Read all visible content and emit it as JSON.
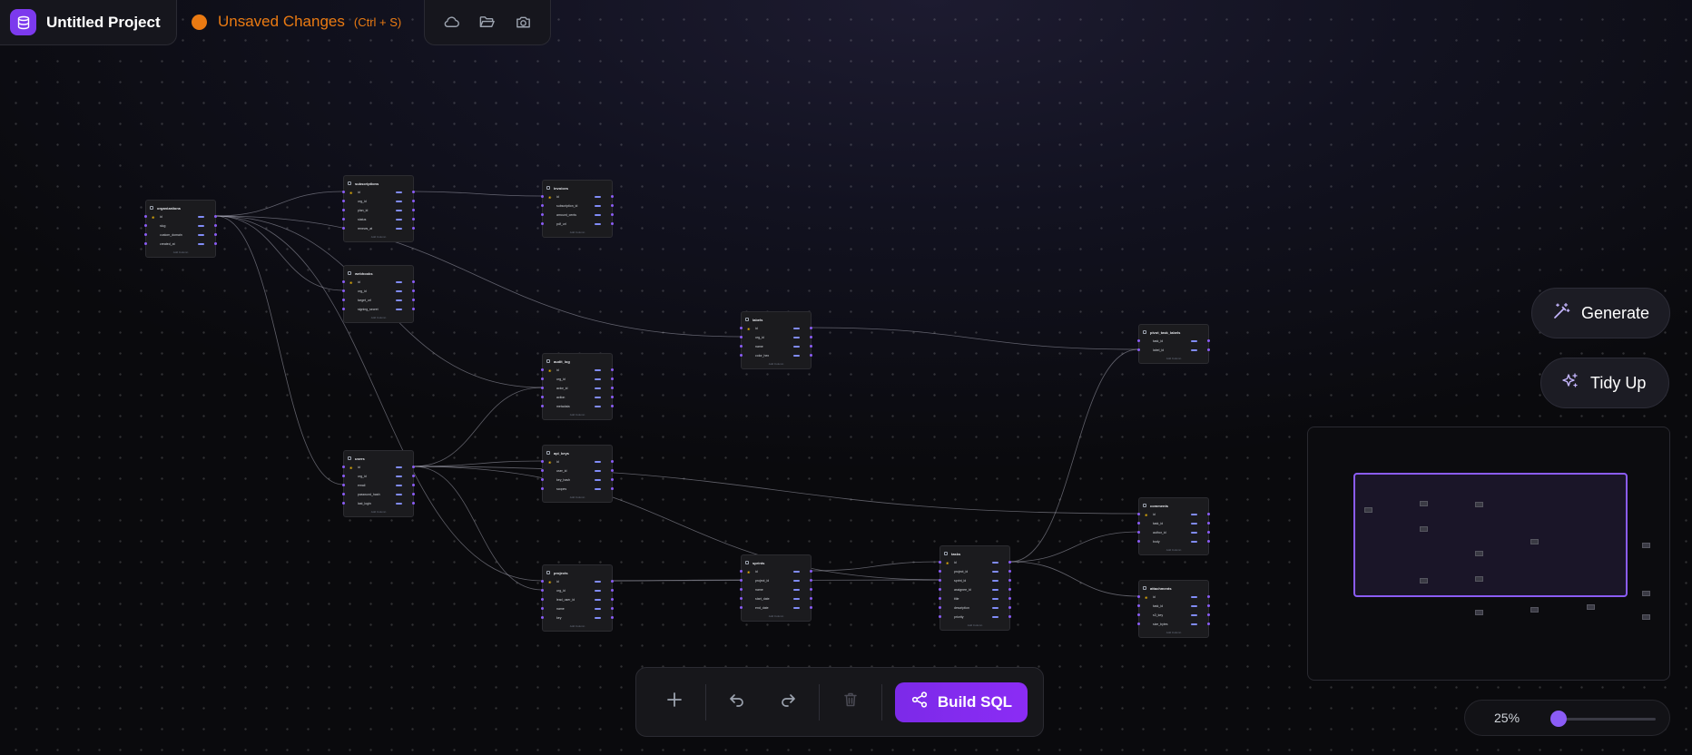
{
  "header": {
    "project_title": "Untitled Project",
    "status_text": "Unsaved Changes",
    "status_shortcut": "(Ctrl + S)",
    "actions": [
      "cloud-icon",
      "folder-open-icon",
      "camera-icon"
    ]
  },
  "colors": {
    "accent": "#8b5cf6",
    "warning": "#ea7a12",
    "build": "#8b2cf5"
  },
  "tables": [
    {
      "name": "organizations",
      "columns": [
        {
          "name": "id",
          "pk": true
        },
        {
          "name": "slug"
        },
        {
          "name": "custom_domain"
        },
        {
          "name": "created_at"
        }
      ],
      "add_label": "Add Column"
    },
    {
      "name": "subscriptions",
      "columns": [
        {
          "name": "id",
          "pk": true
        },
        {
          "name": "org_id"
        },
        {
          "name": "plan_id"
        },
        {
          "name": "status"
        },
        {
          "name": "renews_at"
        }
      ],
      "add_label": "Add Column"
    },
    {
      "name": "invoices",
      "columns": [
        {
          "name": "id",
          "pk": true
        },
        {
          "name": "subscription_id"
        },
        {
          "name": "amount_cents"
        },
        {
          "name": "pdf_url"
        }
      ],
      "add_label": "Add Column"
    },
    {
      "name": "webhooks",
      "columns": [
        {
          "name": "id",
          "pk": true
        },
        {
          "name": "org_id"
        },
        {
          "name": "target_url"
        },
        {
          "name": "signing_secret"
        }
      ],
      "add_label": "Add Column"
    },
    {
      "name": "labels",
      "columns": [
        {
          "name": "id",
          "pk": true
        },
        {
          "name": "org_id"
        },
        {
          "name": "name"
        },
        {
          "name": "color_hex"
        }
      ],
      "add_label": "Add Column"
    },
    {
      "name": "pivot_task_labels",
      "columns": [
        {
          "name": "task_id"
        },
        {
          "name": "label_id"
        }
      ],
      "add_label": "Add Column"
    },
    {
      "name": "audit_log",
      "columns": [
        {
          "name": "id",
          "pk": true
        },
        {
          "name": "org_id"
        },
        {
          "name": "actor_id"
        },
        {
          "name": "action"
        },
        {
          "name": "metadata"
        }
      ],
      "add_label": "Add Column"
    },
    {
      "name": "users",
      "columns": [
        {
          "name": "id",
          "pk": true
        },
        {
          "name": "org_id"
        },
        {
          "name": "email"
        },
        {
          "name": "password_hash"
        },
        {
          "name": "last_login"
        }
      ],
      "add_label": "Add Column"
    },
    {
      "name": "api_keys",
      "columns": [
        {
          "name": "id",
          "pk": true
        },
        {
          "name": "user_id"
        },
        {
          "name": "key_hash"
        },
        {
          "name": "scopes"
        }
      ],
      "add_label": "Add Column"
    },
    {
      "name": "projects",
      "columns": [
        {
          "name": "id",
          "pk": true
        },
        {
          "name": "org_id"
        },
        {
          "name": "lead_user_id"
        },
        {
          "name": "name"
        },
        {
          "name": "key"
        }
      ],
      "add_label": "Add Column"
    },
    {
      "name": "sprints",
      "columns": [
        {
          "name": "id",
          "pk": true
        },
        {
          "name": "project_id"
        },
        {
          "name": "name"
        },
        {
          "name": "start_date"
        },
        {
          "name": "end_date"
        }
      ],
      "add_label": "Add Column"
    },
    {
      "name": "tasks",
      "columns": [
        {
          "name": "id",
          "pk": true
        },
        {
          "name": "project_id"
        },
        {
          "name": "sprint_id"
        },
        {
          "name": "assignee_id"
        },
        {
          "name": "title"
        },
        {
          "name": "description"
        },
        {
          "name": "priority"
        }
      ],
      "add_label": "Add Column"
    },
    {
      "name": "comments",
      "columns": [
        {
          "name": "id",
          "pk": true
        },
        {
          "name": "task_id"
        },
        {
          "name": "author_id"
        },
        {
          "name": "body"
        }
      ],
      "add_label": "Add Column"
    },
    {
      "name": "attachments",
      "columns": [
        {
          "name": "id",
          "pk": true
        },
        {
          "name": "task_id"
        },
        {
          "name": "s3_key"
        },
        {
          "name": "size_bytes"
        }
      ],
      "add_label": "Add Column"
    }
  ],
  "relations": [
    [
      "organizations",
      "subscriptions"
    ],
    [
      "organizations",
      "webhooks"
    ],
    [
      "organizations",
      "users"
    ],
    [
      "organizations",
      "projects"
    ],
    [
      "organizations",
      "labels"
    ],
    [
      "organizations",
      "audit_log"
    ],
    [
      "subscriptions",
      "invoices"
    ],
    [
      "labels",
      "pivot_task_labels"
    ],
    [
      "users",
      "audit_log"
    ],
    [
      "users",
      "api_keys"
    ],
    [
      "users",
      "projects"
    ],
    [
      "users",
      "tasks"
    ],
    [
      "users",
      "comments"
    ],
    [
      "projects",
      "sprints"
    ],
    [
      "projects",
      "tasks"
    ],
    [
      "sprints",
      "tasks"
    ],
    [
      "tasks",
      "pivot_task_labels"
    ],
    [
      "tasks",
      "comments"
    ],
    [
      "tasks",
      "attachments"
    ]
  ],
  "side_buttons": {
    "generate": "Generate",
    "tidy": "Tidy Up"
  },
  "zoom": {
    "label": "25%",
    "value": 0.25
  },
  "toolbar": {
    "build_label": "Build SQL"
  }
}
